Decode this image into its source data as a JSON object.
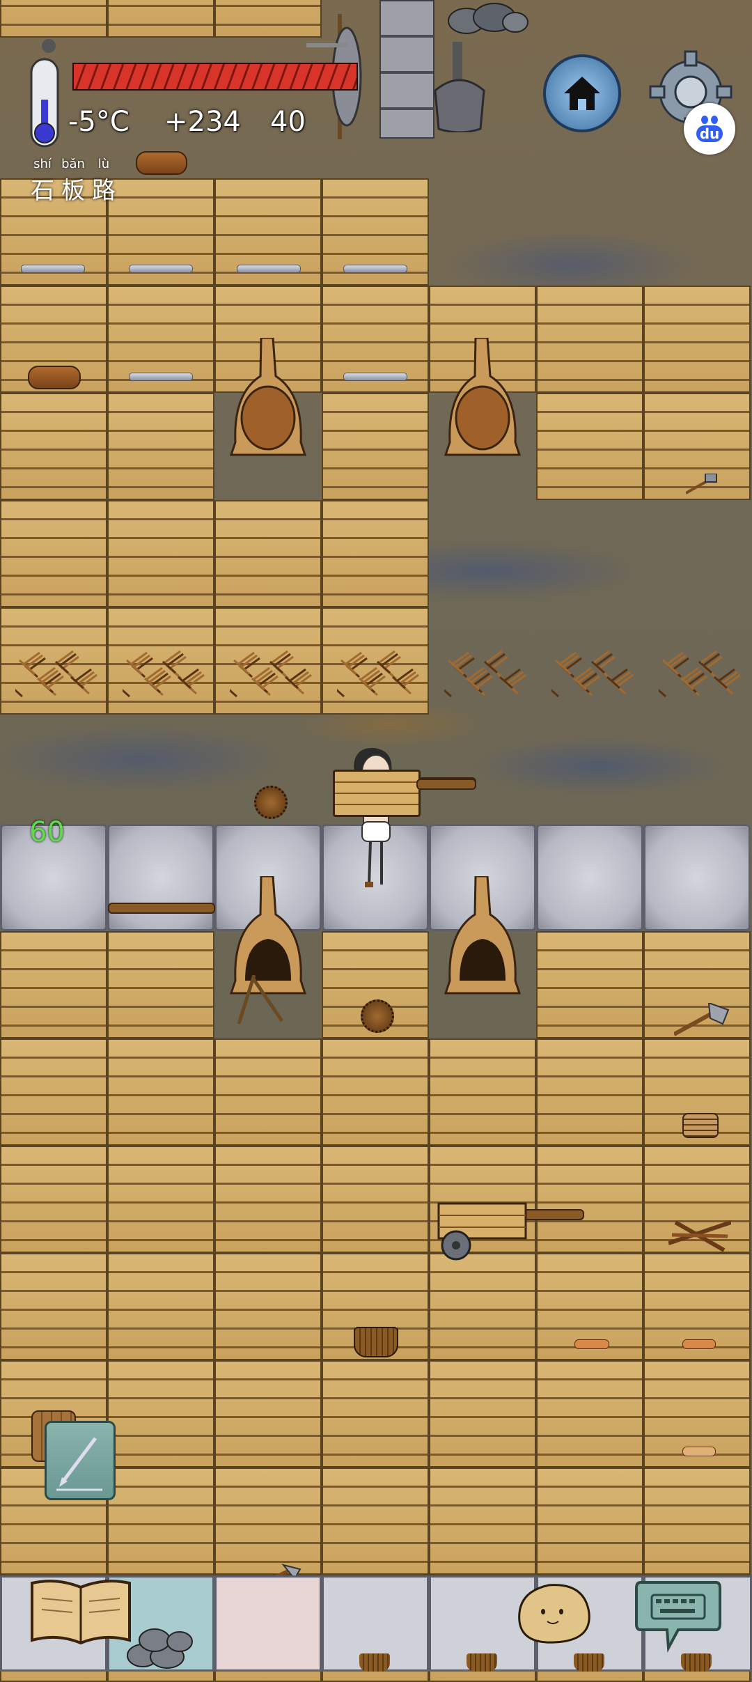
{
  "hud": {
    "temperature": "-5°C",
    "food_bonus": "+234",
    "age": "40",
    "location_pinyin": [
      "shí",
      "bǎn",
      "lù"
    ],
    "location_chars": [
      "石",
      "板",
      "路"
    ],
    "health_percent": 100,
    "floating_number": "60"
  },
  "colors": {
    "health_bar": "#d8342a",
    "thermometer_fill": "#3a3ad0",
    "floating_number": "#5edc4a",
    "plank_floor": "#d2ae6a",
    "stone_floor": "#c4c6cf"
  },
  "buttons": {
    "home_icon": "home-icon",
    "settings_icon": "gear-icon",
    "baidu_label": "du",
    "edit_icon": "pencil-icon",
    "keyboard_icon": "keyboard-icon",
    "book_icon": "book-icon"
  }
}
